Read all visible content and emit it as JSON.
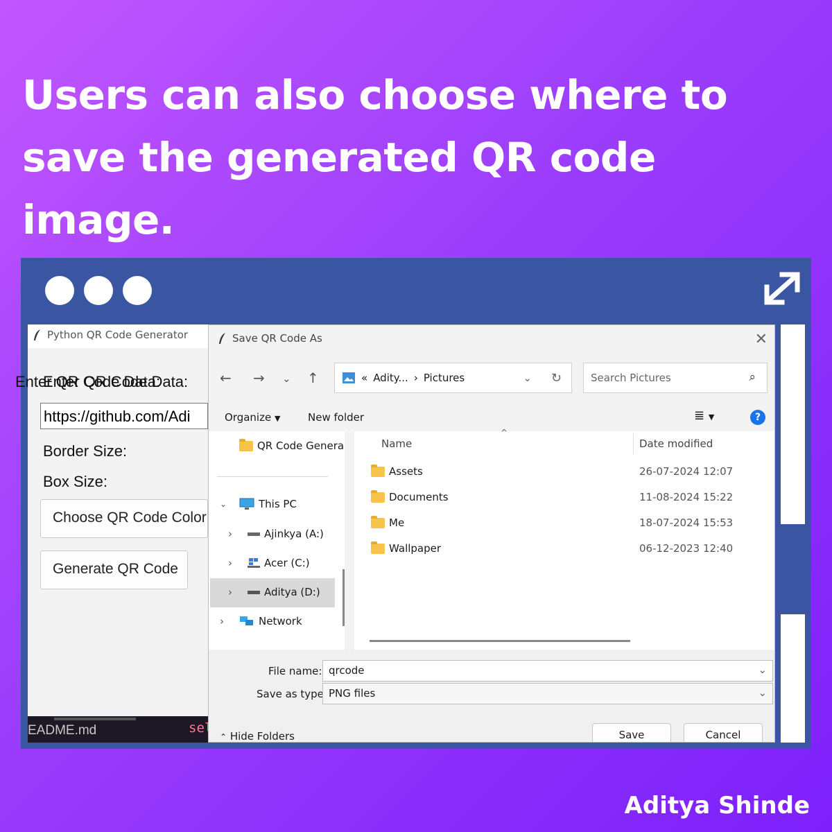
{
  "headline": "Users can also choose where to save the generated QR code image.",
  "author": "Aditya Shinde",
  "app": {
    "title": "Python QR Code Generator",
    "data_label": "Enter QR Code Data:",
    "data_value": "https://github.com/Adi",
    "border_label": "Border Size:",
    "box_label": "Box Size:",
    "color_button": "Choose QR Code Color",
    "generate_button": "Generate QR Code",
    "terminal_file": "EADME.md",
    "terminal_code": "sel"
  },
  "dialog": {
    "title": "Save QR Code As",
    "breadcrumb_prefix": "«",
    "breadcrumb_parent": "Adity...",
    "breadcrumb_sep": "›",
    "breadcrumb_current": "Pictures",
    "search_placeholder": "Search Pictures",
    "organize": "Organize",
    "new_folder": "New folder",
    "nav": {
      "qr_folder": "QR Code Genera",
      "this_pc": "This PC",
      "drive_a": "Ajinkya (A:)",
      "drive_c": "Acer (C:)",
      "drive_d": "Aditya (D:)",
      "network": "Network"
    },
    "columns": {
      "name": "Name",
      "date": "Date modified"
    },
    "files": [
      {
        "name": "Assets",
        "date": "26-07-2024 12:07"
      },
      {
        "name": "Documents",
        "date": "11-08-2024 15:22"
      },
      {
        "name": "Me",
        "date": "18-07-2024 15:53"
      },
      {
        "name": "Wallpaper",
        "date": "06-12-2023 12:40"
      }
    ],
    "file_name_label": "File name:",
    "file_name_value": "qrcode",
    "save_type_label": "Save as type:",
    "save_type_value": "PNG files",
    "hide_folders": "Hide Folders",
    "save_button": "Save",
    "cancel_button": "Cancel"
  }
}
